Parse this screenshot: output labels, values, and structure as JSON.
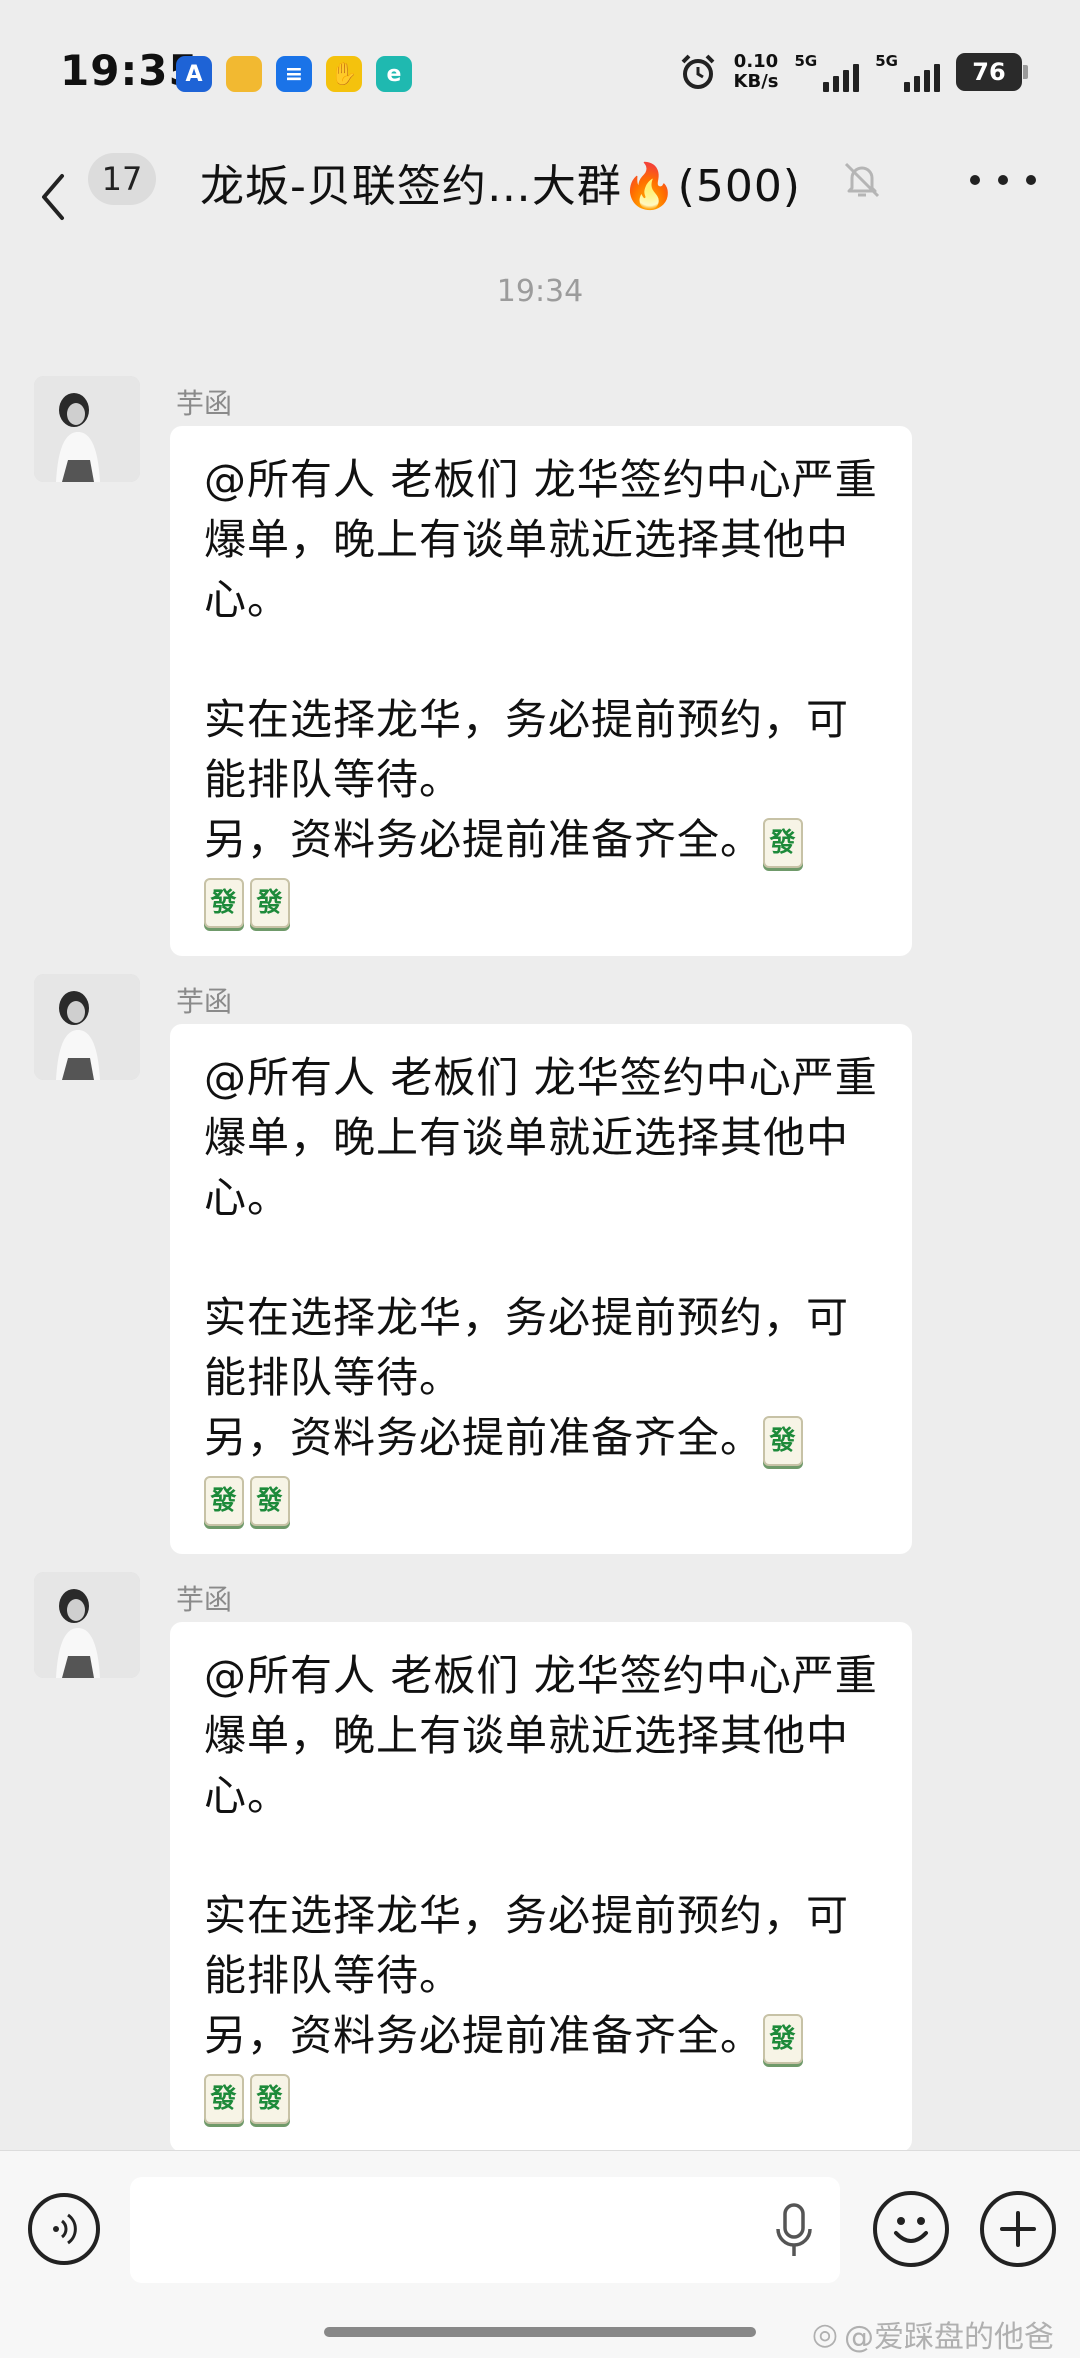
{
  "status_bar": {
    "time": "19:35",
    "net_speed_value": "0.10",
    "net_speed_unit": "KB/s",
    "signal1_label": "5G",
    "signal2_label": "5G",
    "battery": "76",
    "notif_icons": [
      {
        "name": "app-a-icon",
        "glyph": "A",
        "color": "#1e63d6"
      },
      {
        "name": "folder-icon",
        "glyph": "",
        "color": "#f2b931"
      },
      {
        "name": "chat-bubble-icon",
        "glyph": "≡",
        "color": "#1a73e8"
      },
      {
        "name": "hand-icon",
        "glyph": "✋",
        "color": "#f4c20d"
      },
      {
        "name": "refresh-app-icon",
        "glyph": "e",
        "color": "#1fb9b0"
      }
    ]
  },
  "nav": {
    "unread_count": "17",
    "title": "龙坂-贝联签约…大群🔥(500)"
  },
  "timestamp": "19:34",
  "messages": [
    {
      "sender": "芋函",
      "line1": "@所有人  老板们 龙华签约中心严重爆单，晚上有谈单就近选择其他中心。",
      "line2": "实在选择龙华，务必提前预约，可能排队等待。",
      "line3": "另，资料务必提前准备齐全。",
      "emoji_glyph": "發"
    },
    {
      "sender": "芋函",
      "line1": "@所有人  老板们 龙华签约中心严重爆单，晚上有谈单就近选择其他中心。",
      "line2": "实在选择龙华，务必提前预约，可能排队等待。",
      "line3": "另，资料务必提前准备齐全。",
      "emoji_glyph": "發"
    },
    {
      "sender": "芋函",
      "line1": "@所有人  老板们 龙华签约中心严重爆单，晚上有谈单就近选择其他中心。",
      "line2": "实在选择龙华，务必提前预约，可能排队等待。",
      "line3": "另，资料务必提前准备齐全。",
      "emoji_glyph": "發"
    }
  ],
  "input": {
    "value": ""
  },
  "watermark": "@爱踩盘的他爸"
}
